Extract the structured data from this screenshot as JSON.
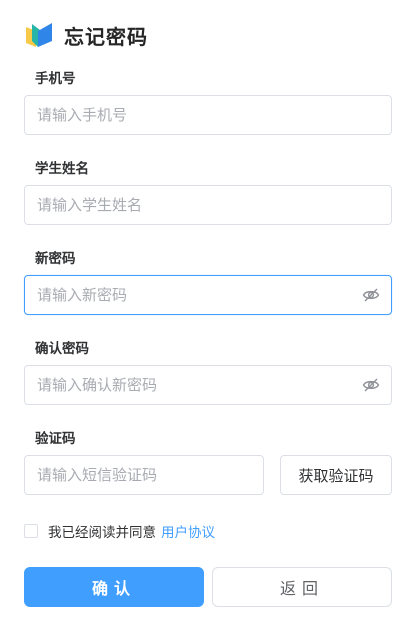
{
  "header": {
    "title": "忘记密码",
    "logo_icon": "book-logo-icon"
  },
  "form": {
    "phone": {
      "label": "手机号",
      "placeholder": "请输入手机号",
      "value": ""
    },
    "student_name": {
      "label": "学生姓名",
      "placeholder": "请输入学生姓名",
      "value": ""
    },
    "new_password": {
      "label": "新密码",
      "placeholder": "请输入新密码",
      "value": "",
      "toggle_icon": "eye-off-icon",
      "focused": true
    },
    "confirm_password": {
      "label": "确认密码",
      "placeholder": "请输入确认新密码",
      "value": "",
      "toggle_icon": "eye-off-icon"
    },
    "code": {
      "label": "验证码",
      "placeholder": "请输入短信验证码",
      "value": "",
      "button_label": "获取验证码"
    }
  },
  "agreement": {
    "checked": false,
    "text": "我已经阅读并同意",
    "link_text": "用户协议"
  },
  "actions": {
    "confirm_label": "确认",
    "back_label": "返回"
  },
  "colors": {
    "primary": "#409eff",
    "border": "#dcdfe6",
    "placeholder": "#a8abb2",
    "logo_yellow": "#f7c948",
    "logo_teal": "#27b5a8",
    "logo_blue": "#2f86e8"
  }
}
